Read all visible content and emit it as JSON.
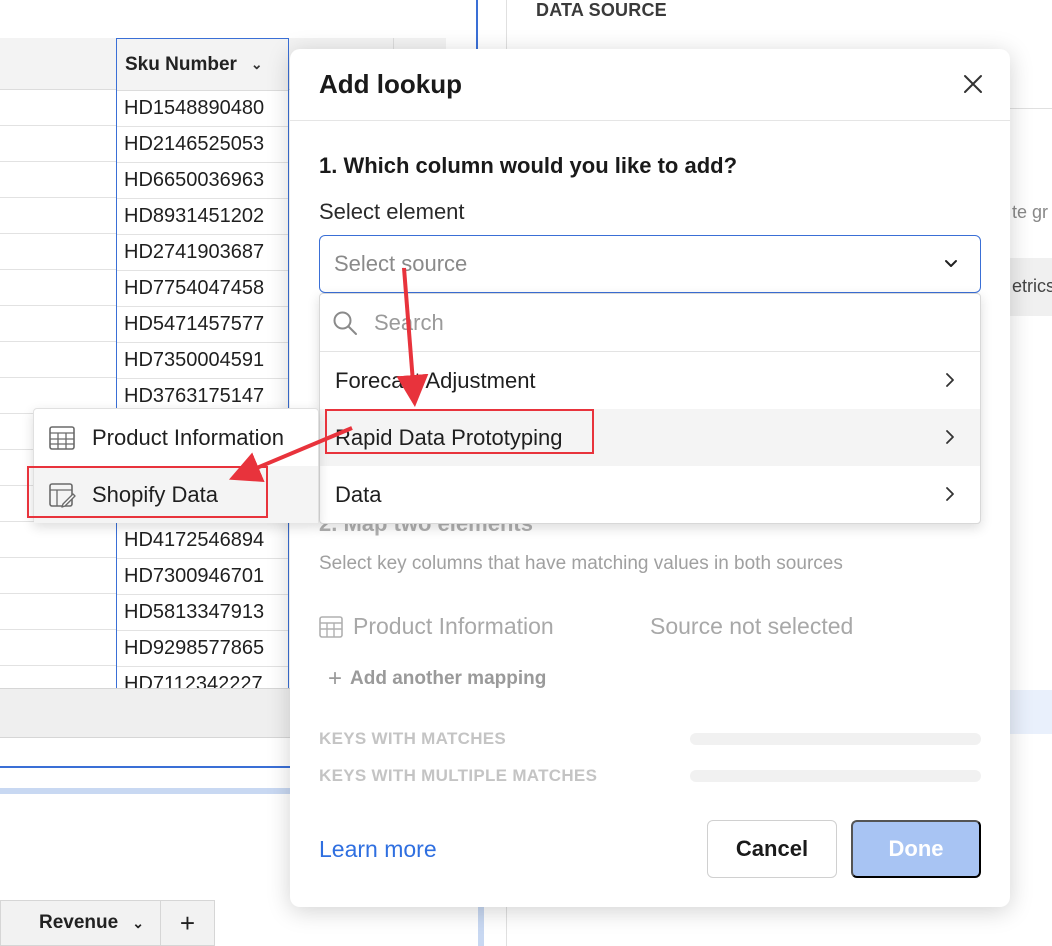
{
  "background": {
    "sku_column": {
      "header": "Sku Number",
      "values": [
        "HD1548890480",
        "HD2146525053",
        "HD6650036963",
        "HD8931451202",
        "HD2741903687",
        "HD7754047458",
        "HD5471457577",
        "HD7350004591",
        "HD3763175147",
        "",
        "",
        "",
        "HD4172546894",
        "HD7300946701",
        "HD5813347913",
        "HD9298577865",
        "HD7112342227"
      ]
    },
    "tab_bar": {
      "tab_label": "Revenue",
      "add_label": "+"
    },
    "right_panel": {
      "section_label": "DATA SOURCE",
      "partial_text": "te gr",
      "partial_metrics": "etrics"
    }
  },
  "modal": {
    "title": "Add lookup",
    "question1": "1. Which column would you like to add?",
    "select_label": "Select element",
    "select_placeholder": "Select source",
    "question2": "2. Map two elements",
    "question2_sub": "Select key columns that have matching values in both sources",
    "map_left": "Product Information",
    "map_right": "Source not selected",
    "add_mapping": "Add another mapping",
    "keys_with_matches": "KEYS WITH MATCHES",
    "keys_with_multiple": "KEYS WITH MULTIPLE MATCHES",
    "learn_more": "Learn more",
    "cancel": "Cancel",
    "done": "Done"
  },
  "dropdown": {
    "search_placeholder": "Search",
    "items": [
      {
        "label": "Forecast Adjustment"
      },
      {
        "label": "Rapid Data Prototyping"
      },
      {
        "label": "Data"
      }
    ]
  },
  "submenu": {
    "items": [
      {
        "label": "Product Information",
        "icon": "table-icon"
      },
      {
        "label": "Shopify Data",
        "icon": "editable-table-icon"
      }
    ]
  },
  "colors": {
    "accent": "#3a6fd6",
    "link": "#2f6fe0",
    "done_disabled": "#a8c4f3",
    "annotation_red": "#e8333c"
  }
}
